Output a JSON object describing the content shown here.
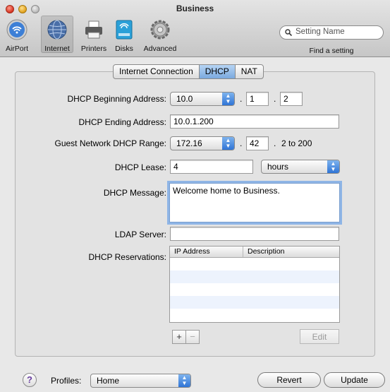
{
  "window": {
    "title": "Business"
  },
  "toolbar": {
    "items": [
      {
        "label": "AirPort",
        "icon": "airport-icon"
      },
      {
        "label": "Internet",
        "icon": "internet-icon"
      },
      {
        "label": "Printers",
        "icon": "printer-icon"
      },
      {
        "label": "Disks",
        "icon": "disk-icon"
      },
      {
        "label": "Advanced",
        "icon": "gear-icon"
      }
    ],
    "selected": "Internet",
    "search_placeholder": "Setting Name",
    "find_label": "Find a setting"
  },
  "tabs": [
    {
      "label": "Internet Connection",
      "active": false
    },
    {
      "label": "DHCP",
      "active": true
    },
    {
      "label": "NAT",
      "active": false
    }
  ],
  "form": {
    "begin_label": "DHCP Beginning Address:",
    "begin_prefix": "10.0",
    "begin_octet3": "1",
    "begin_octet4": "2",
    "end_label": "DHCP Ending Address:",
    "end_value": "10.0.1.200",
    "guest_label": "Guest Network DHCP Range:",
    "guest_prefix": "172.16",
    "guest_octet3": "42",
    "guest_range_suffix": "2 to 200",
    "lease_label": "DHCP Lease:",
    "lease_value": "4",
    "lease_unit": "hours",
    "message_label": "DHCP Message:",
    "message_value": "Welcome home to Business.",
    "ldap_label": "LDAP Server:",
    "ldap_value": "",
    "reservations_label": "DHCP Reservations:",
    "reservations_columns": [
      "IP Address",
      "Description"
    ],
    "add_label": "+",
    "remove_label": "−",
    "edit_label": "Edit"
  },
  "footer": {
    "help_label": "?",
    "profiles_label": "Profiles:",
    "profile_value": "Home",
    "revert_label": "Revert",
    "update_label": "Update"
  },
  "colors": {
    "accent": "#3b7fd9",
    "focus_ring": "#8fb5e6",
    "table_alt_row": "#edf3fd"
  }
}
